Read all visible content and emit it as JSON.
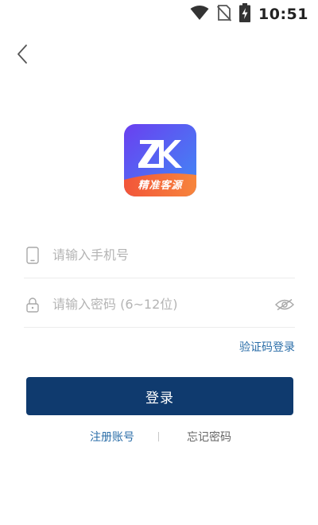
{
  "status_bar": {
    "time": "10:51",
    "icons": [
      "wifi-icon",
      "no-sim-icon",
      "battery-charging-icon"
    ]
  },
  "nav": {
    "back_icon": "chevron-left-icon"
  },
  "logo": {
    "letters": "ZK",
    "tagline": "精准客源"
  },
  "form": {
    "phone": {
      "placeholder": "请输入手机号",
      "value": "",
      "icon": "phone-icon"
    },
    "password": {
      "placeholder": "请输入密码 (6~12位)",
      "value": "",
      "icon": "lock-icon",
      "toggle_icon": "eye-icon"
    },
    "sms_login_label": "验证码登录",
    "login_label": "登录"
  },
  "links": {
    "register_label": "注册账号",
    "forgot_label": "忘记密码"
  },
  "colors": {
    "primary": "#0f3a6e",
    "link": "#2b6ea8",
    "logo_gradient_top": "#5a4ff0",
    "logo_gradient_bottom": "#3f86f5",
    "logo_ribbon": "#f06a3a"
  }
}
